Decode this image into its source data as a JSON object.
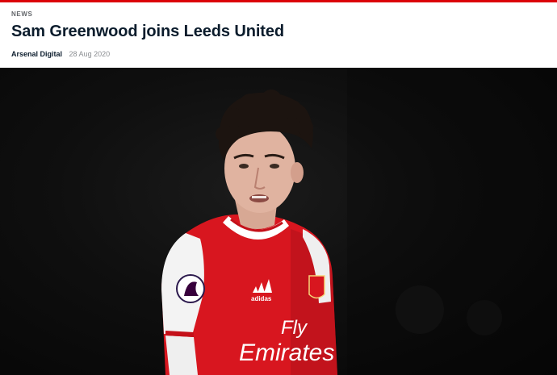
{
  "article": {
    "category": "NEWS",
    "title": "Sam Greenwood joins Leeds United",
    "author": "Arsenal Digital",
    "date": "28 Aug 2020"
  },
  "hero": {
    "shirt_sponsor_line1": "Fly",
    "shirt_sponsor_line2": "Emirates",
    "kit_brand": "adidas",
    "colors": {
      "accent": "#db0007",
      "shirt_red": "#d8161f",
      "sleeve_white": "#f3f3f3",
      "background": "#0b0b0b"
    }
  }
}
